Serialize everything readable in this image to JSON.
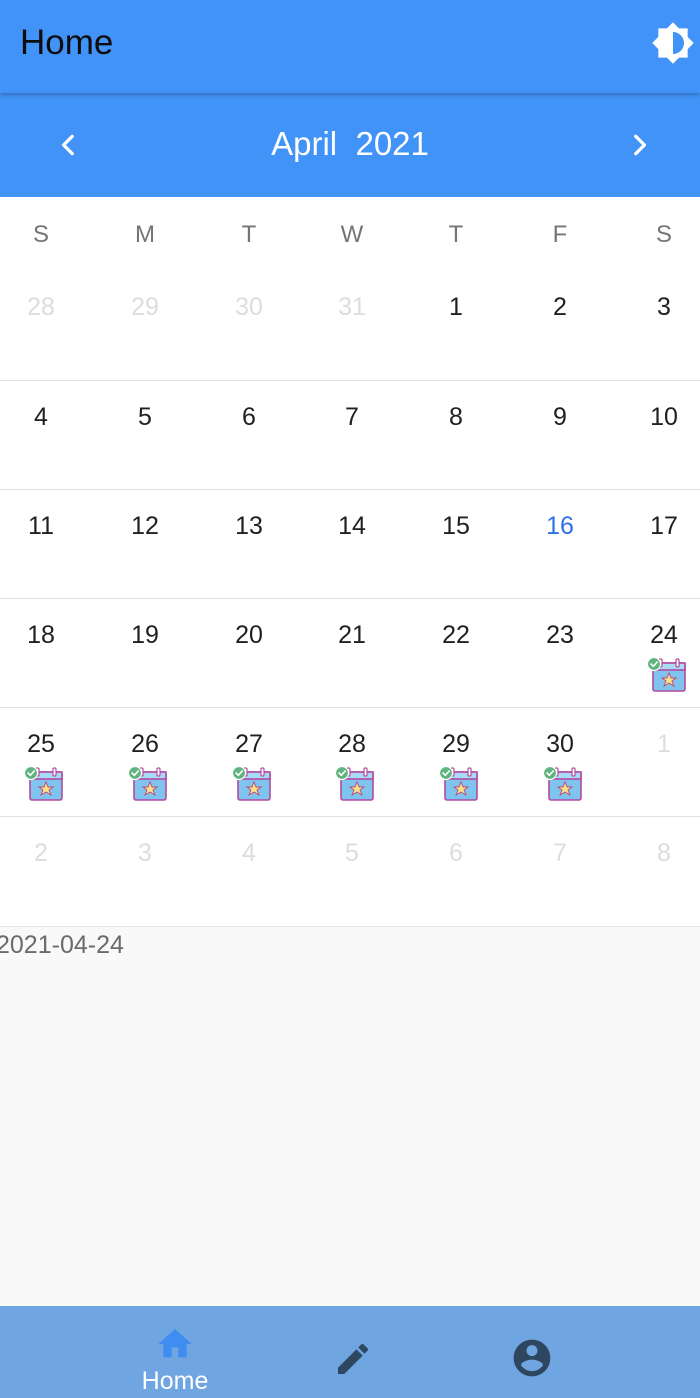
{
  "appbar": {
    "title": "Home",
    "action_icon": "brightness-icon"
  },
  "calendar": {
    "month_label": "April  2021",
    "prev_icon": "chevron-left-icon",
    "next_icon": "chevron-right-icon",
    "weekdays": [
      "S",
      "M",
      "T",
      "W",
      "T",
      "F",
      "S"
    ],
    "weeks": [
      [
        {
          "d": "28",
          "out": true
        },
        {
          "d": "29",
          "out": true
        },
        {
          "d": "30",
          "out": true
        },
        {
          "d": "31",
          "out": true
        },
        {
          "d": "1"
        },
        {
          "d": "2"
        },
        {
          "d": "3"
        }
      ],
      [
        {
          "d": "4"
        },
        {
          "d": "5"
        },
        {
          "d": "6"
        },
        {
          "d": "7"
        },
        {
          "d": "8"
        },
        {
          "d": "9"
        },
        {
          "d": "10"
        }
      ],
      [
        {
          "d": "11"
        },
        {
          "d": "12"
        },
        {
          "d": "13"
        },
        {
          "d": "14"
        },
        {
          "d": "15"
        },
        {
          "d": "16",
          "today": true
        },
        {
          "d": "17"
        }
      ],
      [
        {
          "d": "18"
        },
        {
          "d": "19"
        },
        {
          "d": "20"
        },
        {
          "d": "21"
        },
        {
          "d": "22"
        },
        {
          "d": "23"
        },
        {
          "d": "24",
          "event": true
        }
      ],
      [
        {
          "d": "25",
          "event": true
        },
        {
          "d": "26",
          "event": true
        },
        {
          "d": "27",
          "event": true
        },
        {
          "d": "28",
          "event": true
        },
        {
          "d": "29",
          "event": true
        },
        {
          "d": "30",
          "event": true
        },
        {
          "d": "1",
          "out": true
        }
      ],
      [
        {
          "d": "2",
          "out": true
        },
        {
          "d": "3",
          "out": true
        },
        {
          "d": "4",
          "out": true
        },
        {
          "d": "5",
          "out": true
        },
        {
          "d": "6",
          "out": true
        },
        {
          "d": "7",
          "out": true
        },
        {
          "d": "8",
          "out": true
        }
      ]
    ],
    "event_icon": "calendar-event-check-icon"
  },
  "selected": {
    "date": "2021-04-24"
  },
  "bottom_nav": {
    "items": [
      {
        "label": "Home",
        "icon": "home-icon",
        "active": true
      },
      {
        "label": "",
        "icon": "pencil-icon"
      },
      {
        "label": "",
        "icon": "account-circle-icon"
      }
    ]
  },
  "colors": {
    "primary": "#4293f7",
    "bottom_nav": "#6fa5e0",
    "today": "#2f6fe8",
    "outside_day": "#dddddd",
    "nav_icon_dark": "#2e4660",
    "home_icon": "#3f8df0"
  }
}
